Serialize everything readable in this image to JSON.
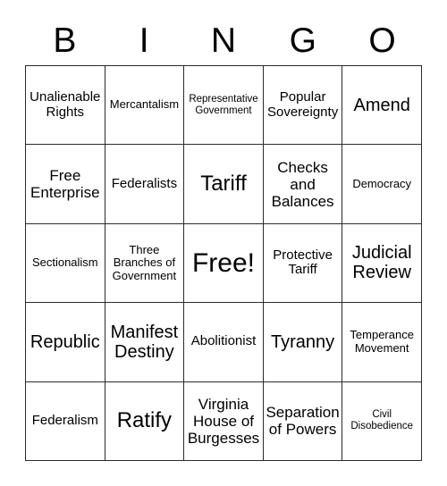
{
  "card": {
    "title": "BINGO",
    "header_letters": [
      "B",
      "I",
      "N",
      "G",
      "O"
    ],
    "columns": 5,
    "rows": 5,
    "border_color": "#2b2b2b",
    "background_color": "#ffffff",
    "text_color": "#000000",
    "free_space_label": "Free!",
    "free_space_position": "center",
    "cells": [
      [
        {
          "text": "Unalienable Rights",
          "size": "md"
        },
        {
          "text": "Mercantalism",
          "size": "sm"
        },
        {
          "text": "Representative Government",
          "size": "xs"
        },
        {
          "text": "Popular Sovereignty",
          "size": "md"
        },
        {
          "text": "Amend",
          "size": "xl"
        }
      ],
      [
        {
          "text": "Free Enterprise",
          "size": "lg"
        },
        {
          "text": "Federalists",
          "size": "md"
        },
        {
          "text": "Tariff",
          "size": "2xl"
        },
        {
          "text": "Checks and Balances",
          "size": "lg"
        },
        {
          "text": "Democracy",
          "size": "sm"
        }
      ],
      [
        {
          "text": "Sectionalism",
          "size": "sm"
        },
        {
          "text": "Three Branches of Government",
          "size": "sm"
        },
        {
          "text": "Free!",
          "size": "3xl"
        },
        {
          "text": "Protective Tariff",
          "size": "md"
        },
        {
          "text": "Judicial Review",
          "size": "xl"
        }
      ],
      [
        {
          "text": "Republic",
          "size": "xl"
        },
        {
          "text": "Manifest Destiny",
          "size": "xl"
        },
        {
          "text": "Abolitionist",
          "size": "md"
        },
        {
          "text": "Tyranny",
          "size": "xl"
        },
        {
          "text": "Temperance Movement",
          "size": "sm"
        }
      ],
      [
        {
          "text": "Federalism",
          "size": "md"
        },
        {
          "text": "Ratify",
          "size": "2xl"
        },
        {
          "text": "Virginia House of Burgesses",
          "size": "lg"
        },
        {
          "text": "Separation of Powers",
          "size": "lg"
        },
        {
          "text": "Civil Disobedience",
          "size": "xs"
        }
      ]
    ]
  }
}
